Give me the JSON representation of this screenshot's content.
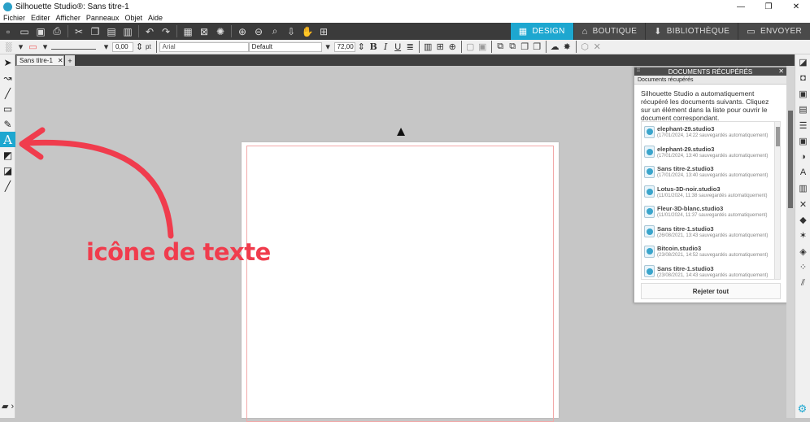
{
  "app": {
    "title": "Silhouette Studio®: Sans titre-1",
    "window_controls": [
      "—",
      "❐",
      "✕"
    ]
  },
  "menu": [
    "Fichier",
    "Editer",
    "Afficher",
    "Panneaux",
    "Objet",
    "Aide"
  ],
  "nav_tabs": [
    {
      "label": "DESIGN",
      "icon": "grid-icon",
      "active": true
    },
    {
      "label": "BOUTIQUE",
      "icon": "shop-icon",
      "active": false
    },
    {
      "label": "BIBLIOTHÈQUE",
      "icon": "library-icon",
      "active": false
    },
    {
      "label": "ENVOYER",
      "icon": "send-icon",
      "active": false
    }
  ],
  "props": {
    "line_width": "0,00",
    "unit": "pt",
    "font": "Arial",
    "style": "Default",
    "font_size": "72,00"
  },
  "doc_tab": {
    "label": "Sans titre-1"
  },
  "annotation": {
    "text": "icône de texte",
    "color": "#f03c4d"
  },
  "panel": {
    "title": "DOCUMENTS RÉCUPÉRÉS",
    "subtitle": "Documents récupérés",
    "description": "Silhouette Studio a automatiquement récupéré les documents suivants. Cliquez sur un élément dans la liste pour ouvrir le document correspondant.",
    "docs": [
      {
        "name": "elephant-29.studio3",
        "meta": "(17/01/2024, 14:22 sauvegardés automatiquement)"
      },
      {
        "name": "elephant-29.studio3",
        "meta": "(17/01/2024, 13:40 sauvegardés automatiquement)"
      },
      {
        "name": "Sans titre-2.studio3",
        "meta": "(17/01/2024, 13:40 sauvegardés automatiquement)"
      },
      {
        "name": "Lotus-3D-noir.studio3",
        "meta": "(11/01/2024, 11:38 sauvegardés automatiquement)"
      },
      {
        "name": "Fleur-3D-blanc.studio3",
        "meta": "(11/01/2024, 11:37 sauvegardés automatiquement)"
      },
      {
        "name": "Sans titre-1.studio3",
        "meta": "(26/08/2021, 13:43 sauvegardés automatiquement)"
      },
      {
        "name": "Bitcoin.studio3",
        "meta": "(23/08/2021, 14:52 sauvegardés automatiquement)"
      },
      {
        "name": "Sans titre-1.studio3",
        "meta": "(23/08/2021, 14:43 sauvegardés automatiquement)"
      }
    ],
    "reject_label": "Rejeter tout"
  },
  "colors": {
    "accent": "#1da7d0",
    "toolbar_dark": "#3b3b3b",
    "annotation": "#f03c4d"
  }
}
